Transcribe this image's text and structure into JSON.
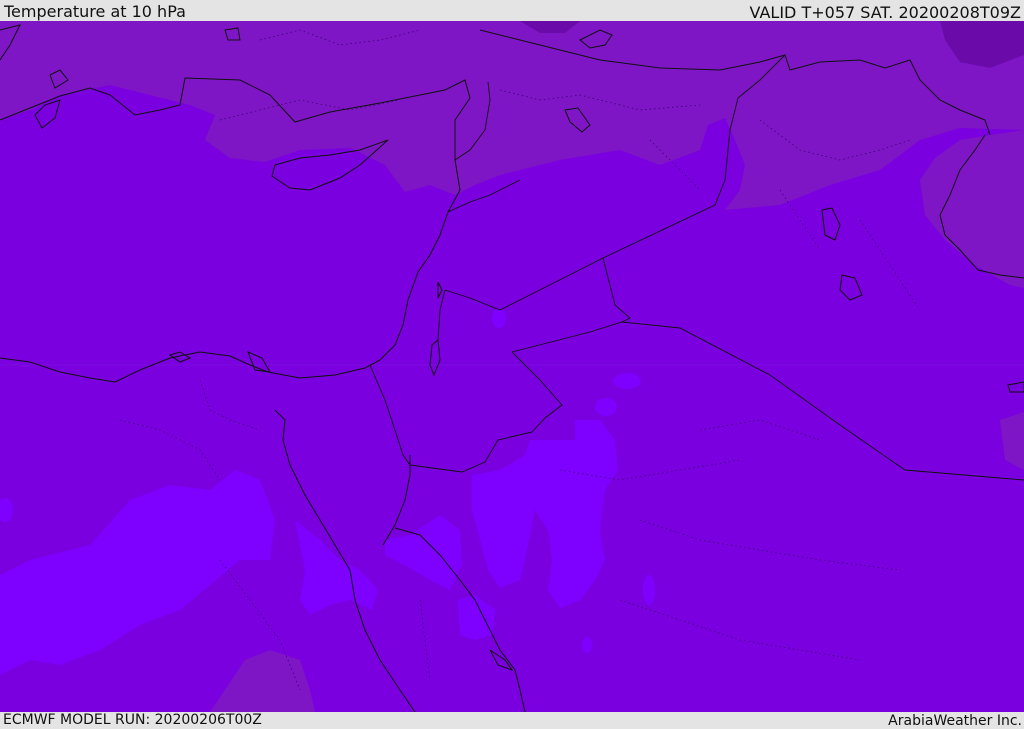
{
  "header": {
    "title": "Temperature at 10 hPa",
    "valid": "VALID T+057 SAT. 20200208T09Z"
  },
  "footer": {
    "model_run": "ECMWF MODEL RUN: 20200206T00Z",
    "credit": "ArabiaWeather Inc."
  },
  "colors": {
    "base": "#7a00df",
    "warm_band": "#7e16c6",
    "warmest": "#6a0aa8",
    "cool_patch": "#7e00ff",
    "border": "#111111",
    "bar_bg": "#e4e4e4"
  }
}
